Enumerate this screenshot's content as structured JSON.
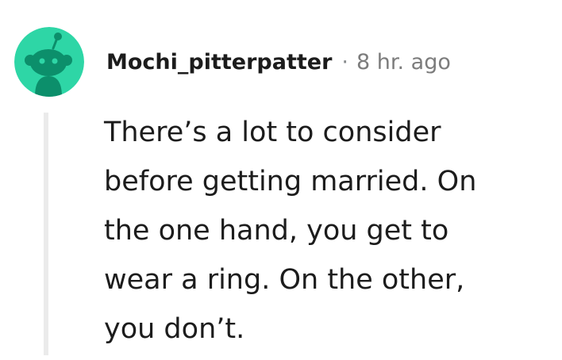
{
  "comment": {
    "author": "Mochi_pitterpatter",
    "separator": "·",
    "timestamp": "8 hr. ago",
    "body_lines": [
      "There’s a lot to consider",
      "before getting married. On",
      "the one hand, you get to",
      "wear a ring. On the other,",
      "you don’t."
    ]
  },
  "avatar": {
    "icon": "snoo-avatar-icon",
    "background_color": "#2ed6a6",
    "figure_color": "#0c8f6b"
  },
  "colors": {
    "thread_line": "#ebebeb",
    "text": "#1c1c1c",
    "muted": "#7c7c7c"
  }
}
